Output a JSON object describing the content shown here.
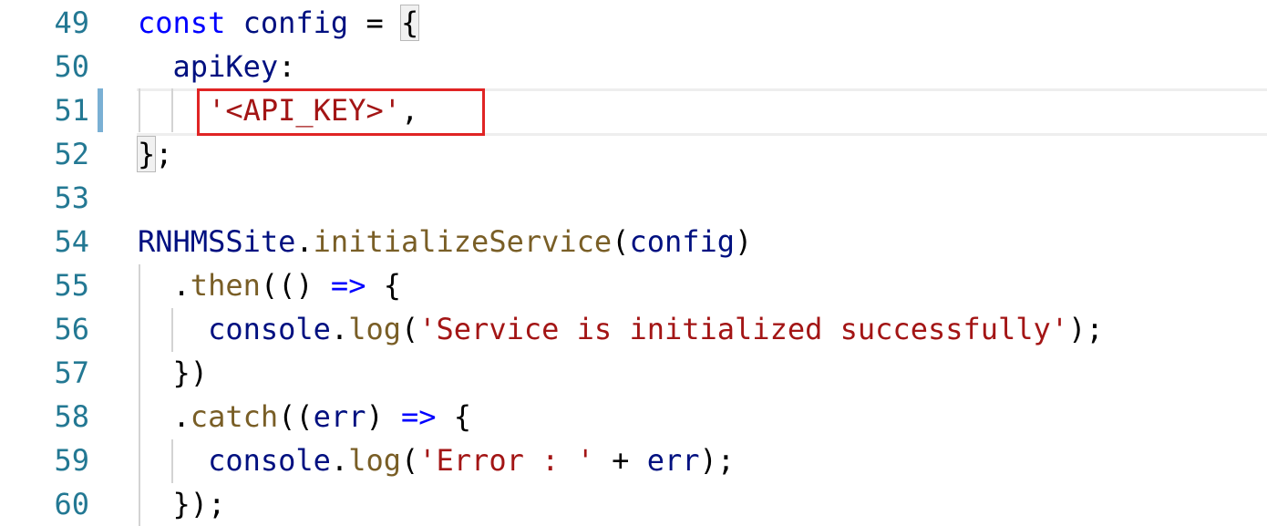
{
  "editor": {
    "lines": [
      {
        "number": "49",
        "tokens": [
          {
            "t": "const",
            "c": "kw"
          },
          {
            "t": " ",
            "c": "pl"
          },
          {
            "t": "config",
            "c": "var"
          },
          {
            "t": " = ",
            "c": "pl"
          },
          {
            "t": "{",
            "c": "pl",
            "box": true
          }
        ]
      },
      {
        "number": "50",
        "tokens": [
          {
            "t": "  ",
            "c": "pl"
          },
          {
            "t": "apiKey",
            "c": "var"
          },
          {
            "t": ":",
            "c": "pl"
          }
        ]
      },
      {
        "number": "51",
        "tokens": [
          {
            "t": "    ",
            "c": "pl"
          },
          {
            "t": "'<API_KEY>'",
            "c": "str"
          },
          {
            "t": ",",
            "c": "pl"
          }
        ]
      },
      {
        "number": "52",
        "tokens": [
          {
            "t": "}",
            "c": "pl",
            "box": true
          },
          {
            "t": ";",
            "c": "pl"
          }
        ]
      },
      {
        "number": "53",
        "tokens": []
      },
      {
        "number": "54",
        "tokens": [
          {
            "t": "RNHMSSite",
            "c": "var"
          },
          {
            "t": ".",
            "c": "pl"
          },
          {
            "t": "initializeService",
            "c": "fn"
          },
          {
            "t": "(",
            "c": "pl"
          },
          {
            "t": "config",
            "c": "var"
          },
          {
            "t": ")",
            "c": "pl"
          }
        ]
      },
      {
        "number": "55",
        "tokens": [
          {
            "t": "  .",
            "c": "pl"
          },
          {
            "t": "then",
            "c": "fn"
          },
          {
            "t": "(() ",
            "c": "pl"
          },
          {
            "t": "=>",
            "c": "kw"
          },
          {
            "t": " {",
            "c": "pl"
          }
        ]
      },
      {
        "number": "56",
        "tokens": [
          {
            "t": "    ",
            "c": "pl"
          },
          {
            "t": "console",
            "c": "var"
          },
          {
            "t": ".",
            "c": "pl"
          },
          {
            "t": "log",
            "c": "fn"
          },
          {
            "t": "(",
            "c": "pl"
          },
          {
            "t": "'Service is initialized successfully'",
            "c": "str"
          },
          {
            "t": ");",
            "c": "pl"
          }
        ]
      },
      {
        "number": "57",
        "tokens": [
          {
            "t": "  })",
            "c": "pl"
          }
        ]
      },
      {
        "number": "58",
        "tokens": [
          {
            "t": "  .",
            "c": "pl"
          },
          {
            "t": "catch",
            "c": "fn"
          },
          {
            "t": "((",
            "c": "pl"
          },
          {
            "t": "err",
            "c": "var"
          },
          {
            "t": ") ",
            "c": "pl"
          },
          {
            "t": "=>",
            "c": "kw"
          },
          {
            "t": " {",
            "c": "pl"
          }
        ]
      },
      {
        "number": "59",
        "tokens": [
          {
            "t": "    ",
            "c": "pl"
          },
          {
            "t": "console",
            "c": "var"
          },
          {
            "t": ".",
            "c": "pl"
          },
          {
            "t": "log",
            "c": "fn"
          },
          {
            "t": "(",
            "c": "pl"
          },
          {
            "t": "'Error : '",
            "c": "str"
          },
          {
            "t": " + ",
            "c": "pl"
          },
          {
            "t": "err",
            "c": "var"
          },
          {
            "t": ");",
            "c": "pl"
          }
        ]
      },
      {
        "number": "60",
        "tokens": [
          {
            "t": "  });",
            "c": "pl"
          }
        ]
      }
    ],
    "current_line": "51"
  },
  "colors": {
    "keyword": "#0000ff",
    "variable": "#001080",
    "function": "#795e26",
    "string": "#a31515",
    "line_number": "#237893",
    "highlight_box": "#e02424"
  }
}
